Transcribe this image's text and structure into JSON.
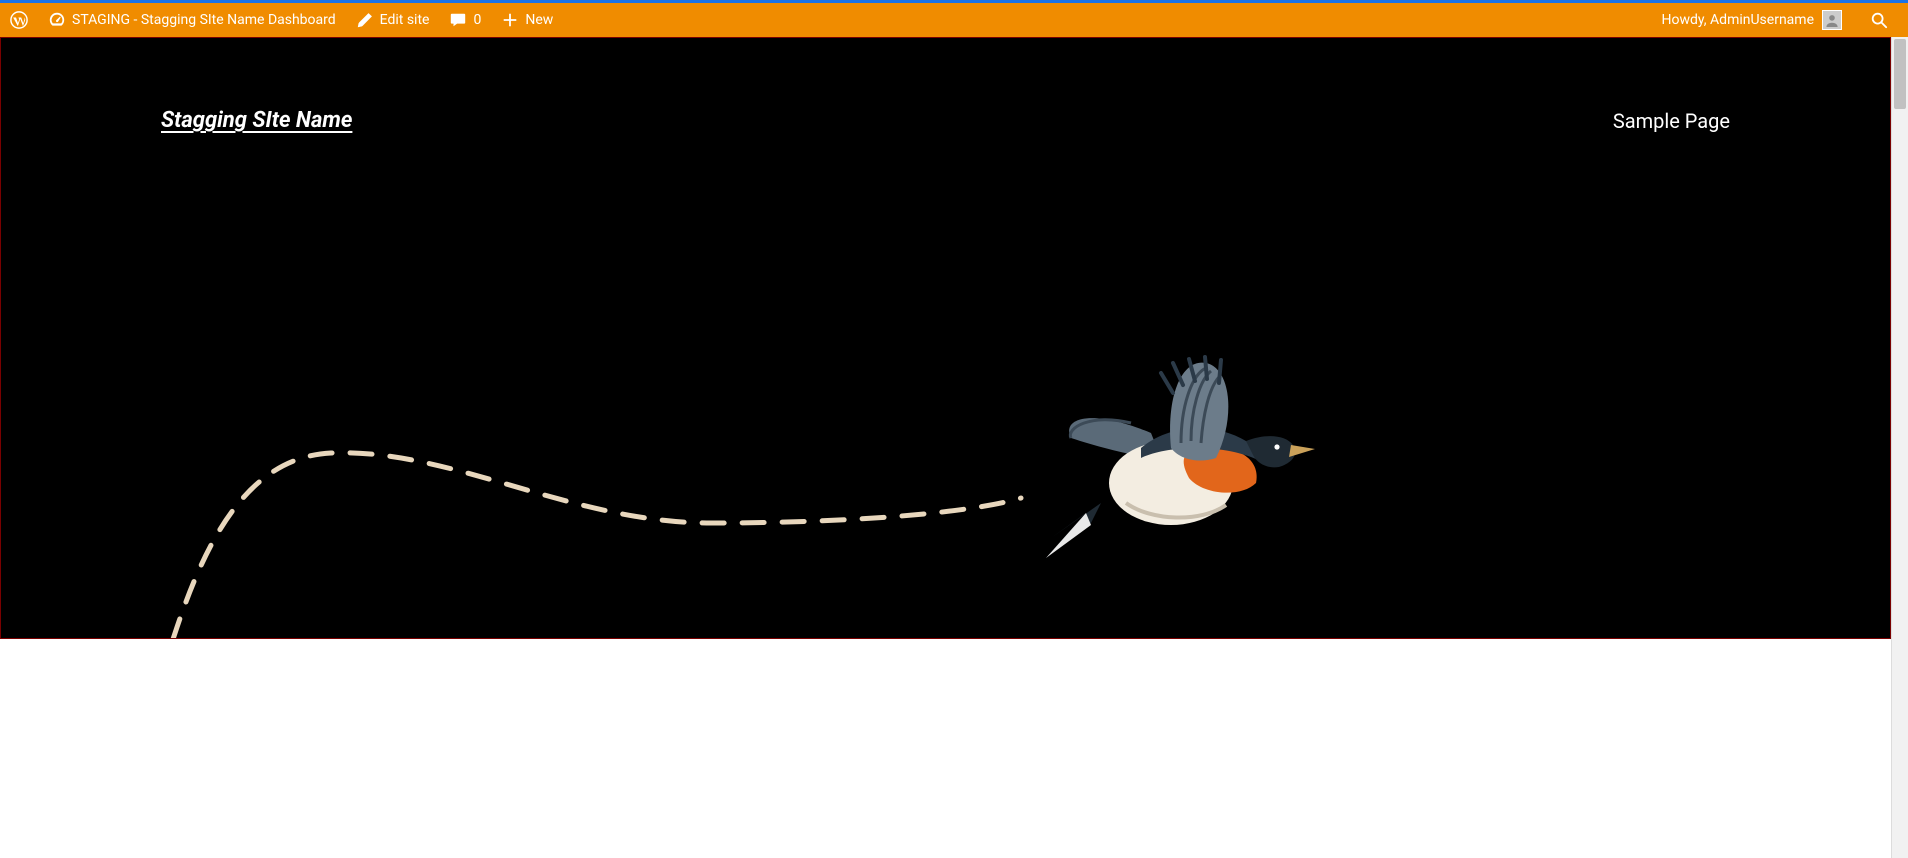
{
  "adminbar": {
    "site_label": "STAGING - Stagging SIte Name Dashboard",
    "edit_site": "Edit site",
    "comments_count": "0",
    "new_label": "New",
    "howdy": "Howdy, AdminUsername"
  },
  "site": {
    "title": "Stagging SIte Name",
    "nav": {
      "sample_page": "Sample Page"
    }
  },
  "colors": {
    "adminbar_bg": "#f08c00",
    "hero_bg": "#000000",
    "hero_border": "#7a0000"
  }
}
